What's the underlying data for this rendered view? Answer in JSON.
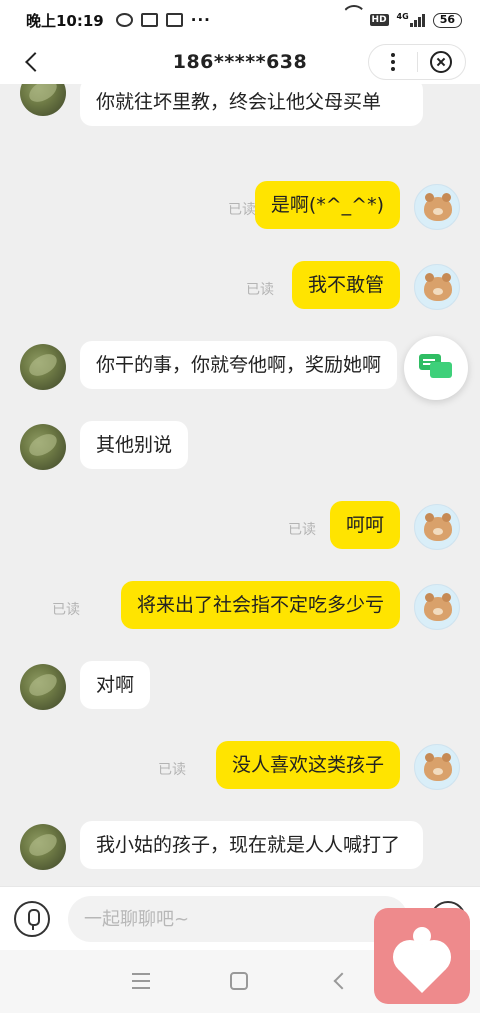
{
  "status_bar": {
    "time": "晚上10:19",
    "hd": "HD",
    "network": "4G",
    "battery": "56"
  },
  "header": {
    "title": "186*****638"
  },
  "messages": [
    {
      "side": "other",
      "text": "你就往坏里教，终会让他父母买单"
    },
    {
      "side": "self",
      "text": "是啊(*^_^*)",
      "read": "已读"
    },
    {
      "side": "self",
      "text": "我不敢管",
      "read": "已读"
    },
    {
      "side": "other",
      "text": "你干的事，你就夸他啊，奖励她啊"
    },
    {
      "side": "other",
      "text": "其他别说"
    },
    {
      "side": "self",
      "text": "呵呵",
      "read": "已读"
    },
    {
      "side": "self",
      "text": "将来出了社会指不定吃多少亏",
      "read": "已读"
    },
    {
      "side": "other",
      "text": "对啊"
    },
    {
      "side": "self",
      "text": "没人喜欢这类孩子",
      "read": "已读"
    },
    {
      "side": "other",
      "text": "我小姑的孩子，现在就是人人喊打了"
    }
  ],
  "input": {
    "placeholder": "一起聊聊吧~"
  },
  "colors": {
    "self_bubble": "#ffe400",
    "other_bubble": "#ffffff",
    "background": "#efefef",
    "heart_app": "#ee8a8c"
  }
}
